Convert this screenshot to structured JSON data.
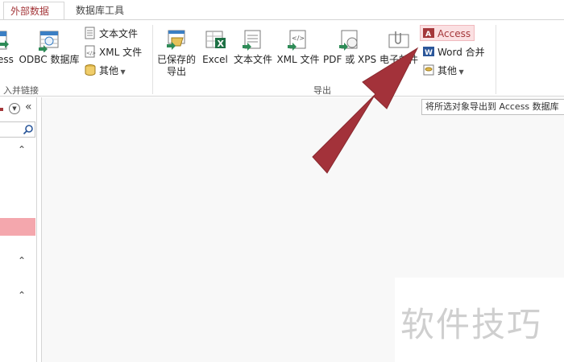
{
  "tabs": [
    {
      "label": "外部数据",
      "active": true
    },
    {
      "label": "数据库工具",
      "active": false
    }
  ],
  "import_group": {
    "label": "入并链接",
    "access_partial": "ess",
    "odbc": "ODBC 数据库",
    "text_file": "文本文件",
    "xml_file": "XML 文件",
    "more": "其他"
  },
  "export_group": {
    "label": "导出",
    "saved_exports": [
      "已保存的",
      "导出"
    ],
    "excel": "Excel",
    "text_file": "文本文件",
    "xml_file": "XML 文件",
    "pdf_xps": "PDF 或 XPS",
    "email": "电子邮件",
    "access": "Access",
    "word_merge": "Word 合并",
    "more": "其他"
  },
  "tooltip": "将所选对象导出到 Access 数据库",
  "nav": {
    "header_glyph": "▼",
    "collapse_glyph": "«",
    "section_glyph": "⌃"
  },
  "watermark": "软件技巧",
  "colors": {
    "accent": "#a4373a",
    "highlight": "#fbe0e2",
    "nav_selection": "#f4a7ad",
    "arrow": "#a3323a"
  }
}
